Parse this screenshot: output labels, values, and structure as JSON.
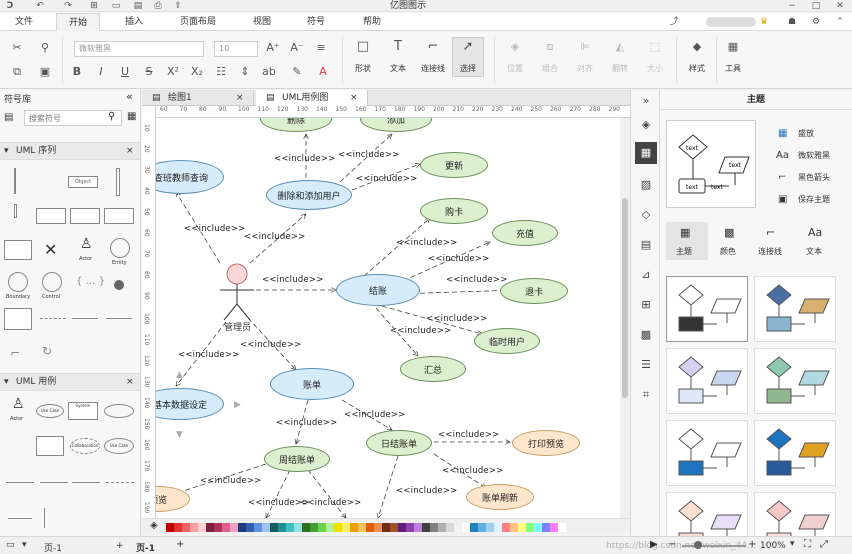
{
  "app": {
    "title": "亿图图示"
  },
  "menu": {
    "items": [
      "文件",
      "开始",
      "插入",
      "页面布局",
      "视图",
      "符号",
      "帮助"
    ],
    "active": "开始"
  },
  "toolbar": {
    "font_family": "微软雅黑",
    "font_size": "10",
    "shape_label": "形状",
    "text_label": "文本",
    "connector_label": "连接线",
    "select_label": "选择",
    "position_label": "位置",
    "group_label": "组合",
    "align_label": "对齐",
    "rotate_label": "翻转",
    "size_label": "大小",
    "style_label": "样式",
    "tools_label": "工具"
  },
  "library": {
    "title": "符号库",
    "search_placeholder": "搜索符号",
    "sections": [
      {
        "title": "UML 序列",
        "labels": [
          "Object",
          "Actor",
          "Entity",
          "Boundary",
          "Control"
        ]
      },
      {
        "title": "UML 用例",
        "labels": [
          "Actor",
          "Use Case",
          "System",
          "Collaboration",
          "Use Case"
        ]
      }
    ]
  },
  "tabs": [
    {
      "label": "绘图1"
    },
    {
      "label": "UML用例图"
    }
  ],
  "ruler": {
    "h": [
      "60",
      "70",
      "80",
      "90",
      "100",
      "110",
      "120",
      "130",
      "140",
      "150",
      "160",
      "170",
      "180",
      "190",
      "200",
      "210",
      "220",
      "230",
      "240",
      "250",
      "260",
      "270",
      "280",
      "290"
    ],
    "v": [
      "10",
      "20",
      "30",
      "40",
      "50",
      "60",
      "70",
      "80",
      "90",
      "100",
      "110",
      "120",
      "130",
      "140",
      "150",
      "160",
      "170",
      "180",
      "190"
    ]
  },
  "diagram": {
    "actor": "管理员",
    "include": "<<include>>",
    "nodes": {
      "delete": "删除",
      "add": "添加",
      "query": "查班教师查询",
      "deladd": "删除和添加用户",
      "update": "更新",
      "buy": "购卡",
      "recharge": "充值",
      "settle": "结账",
      "refund": "退卡",
      "summary": "汇总",
      "temp": "临时用户",
      "basic": "基本数据设定",
      "bill": "账单",
      "weekly": "周结账单",
      "daily": "日结账单",
      "print": "打印预览",
      "preview": "预览",
      "refresh": "账单刷新"
    }
  },
  "statusbar": {
    "page_selector": "页-1",
    "page_tab": "页-1",
    "zoom": "100%",
    "watermark": "https://blog.csdn.net/weixin_44..."
  },
  "theme": {
    "title": "主题",
    "options": [
      "盛放",
      "微软雅黑",
      "黑色箭头",
      "保存主题"
    ],
    "tabs": [
      "主题",
      "颜色",
      "连接线",
      "文本"
    ],
    "colors": {
      "accent": "#1e73be",
      "selected_tab": "#e4e4e4"
    }
  }
}
